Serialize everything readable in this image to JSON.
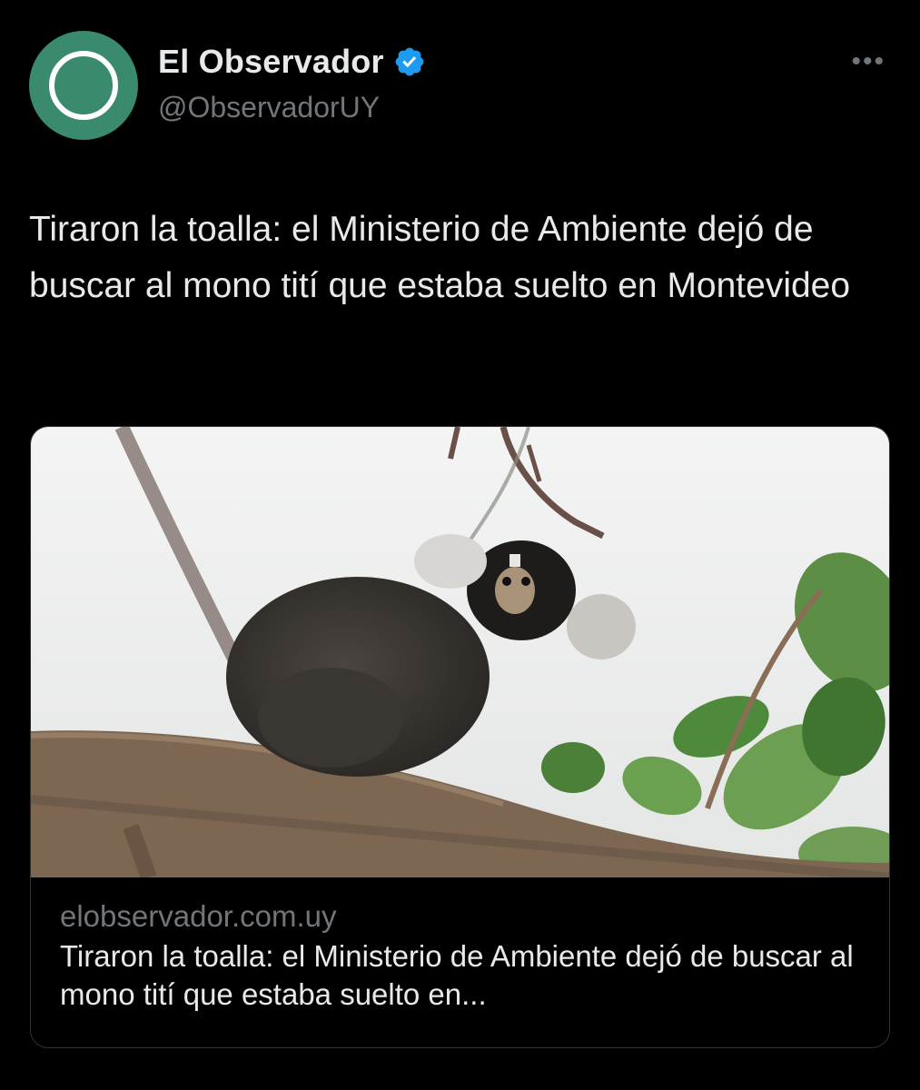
{
  "account": {
    "display_name": "El Observador",
    "handle": "@ObservadorUY",
    "verified": true,
    "avatar_color": "#3a8a6e"
  },
  "tweet": {
    "text": "Tiraron la toalla: el Ministerio de Ambiente dejó de buscar al mono tití que estaba suelto en Montevideo"
  },
  "link_card": {
    "domain": "elobservador.com.uy",
    "title": "Tiraron la toalla: el Ministerio de Ambiente dejó de buscar al mono tití que estaba suelto en...",
    "image_alt": "marmoset-on-branch-photo"
  },
  "icons": {
    "more": "more-horizontal-icon",
    "verified": "verified-badge-icon"
  },
  "colors": {
    "background": "#000000",
    "text_primary": "#e7e9ea",
    "text_secondary": "#71767b",
    "verified_blue": "#1d9bf0"
  }
}
